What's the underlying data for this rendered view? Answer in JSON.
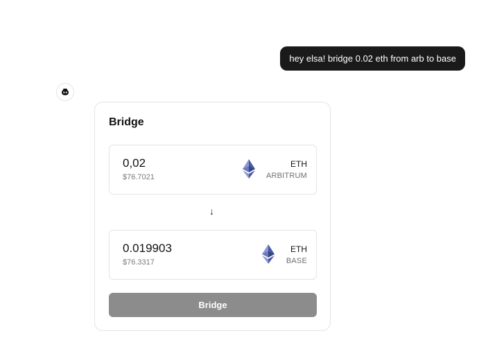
{
  "chat": {
    "user_message": "hey elsa! bridge 0.02 eth from arb to base",
    "assistant_avatar_icon": "bot-face-icon"
  },
  "bridge_card": {
    "title": "Bridge",
    "from": {
      "amount": "0,02",
      "usd_value": "$76.7021",
      "token_symbol": "ETH",
      "network": "ARBITRUM",
      "token_icon": "ethereum-icon"
    },
    "direction_arrow": "↓",
    "to": {
      "amount": "0.019903",
      "usd_value": "$76.3317",
      "token_symbol": "ETH",
      "network": "BASE",
      "token_icon": "ethereum-icon"
    },
    "action_label": "Bridge"
  },
  "colors": {
    "user_bubble_bg": "#1a1a1a",
    "button_bg": "#8c8c8c",
    "eth_logo": "#627eea"
  }
}
